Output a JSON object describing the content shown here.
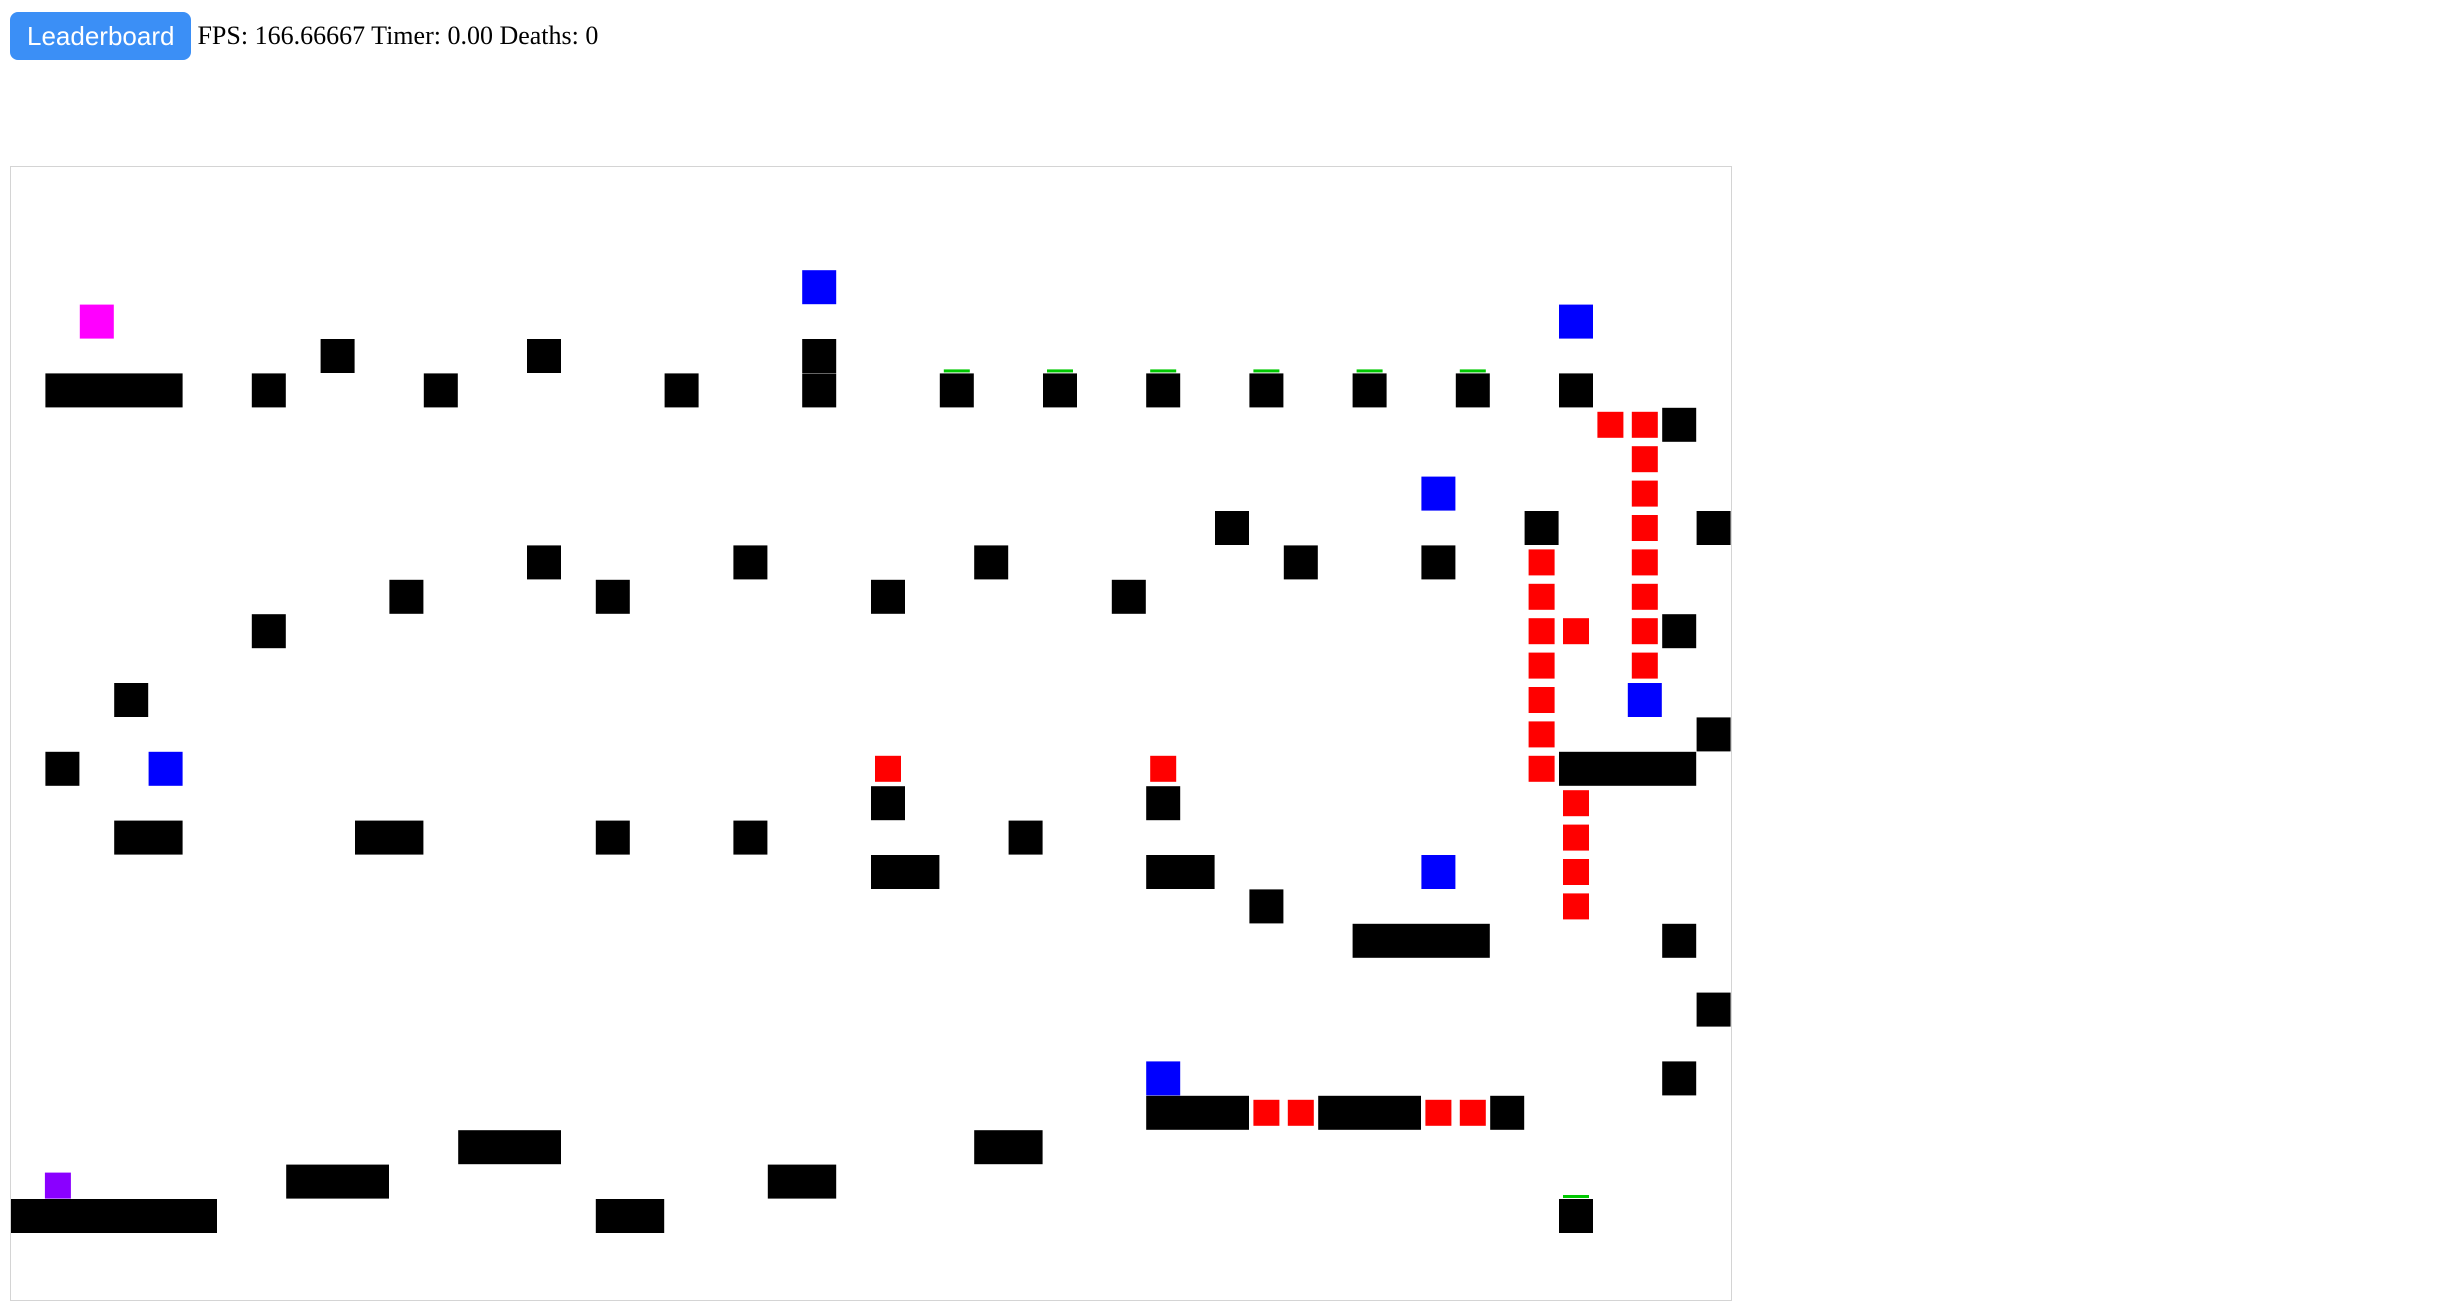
{
  "header": {
    "leaderboard_label": "Leaderboard"
  },
  "stats": {
    "fps_label": "FPS:",
    "fps": "166.66667",
    "timer_label": "Timer:",
    "timer": "0.00",
    "deaths_label": "Deaths:",
    "deaths": "0"
  },
  "colors": {
    "button": "#3b8ff6",
    "platform": "#000000",
    "hazard": "#ff0000",
    "checkpoint": "#0000ff",
    "goal": "#ff00ff",
    "player": "#8a00ff",
    "bounce_pad": "#00c800",
    "canvas_border": "#d4d4d4"
  },
  "icons": {
    "player": "purple-square",
    "goal": "magenta-square",
    "checkpoint": "blue-square",
    "hazard": "red-square",
    "bounce_pad": "green-strip"
  }
}
